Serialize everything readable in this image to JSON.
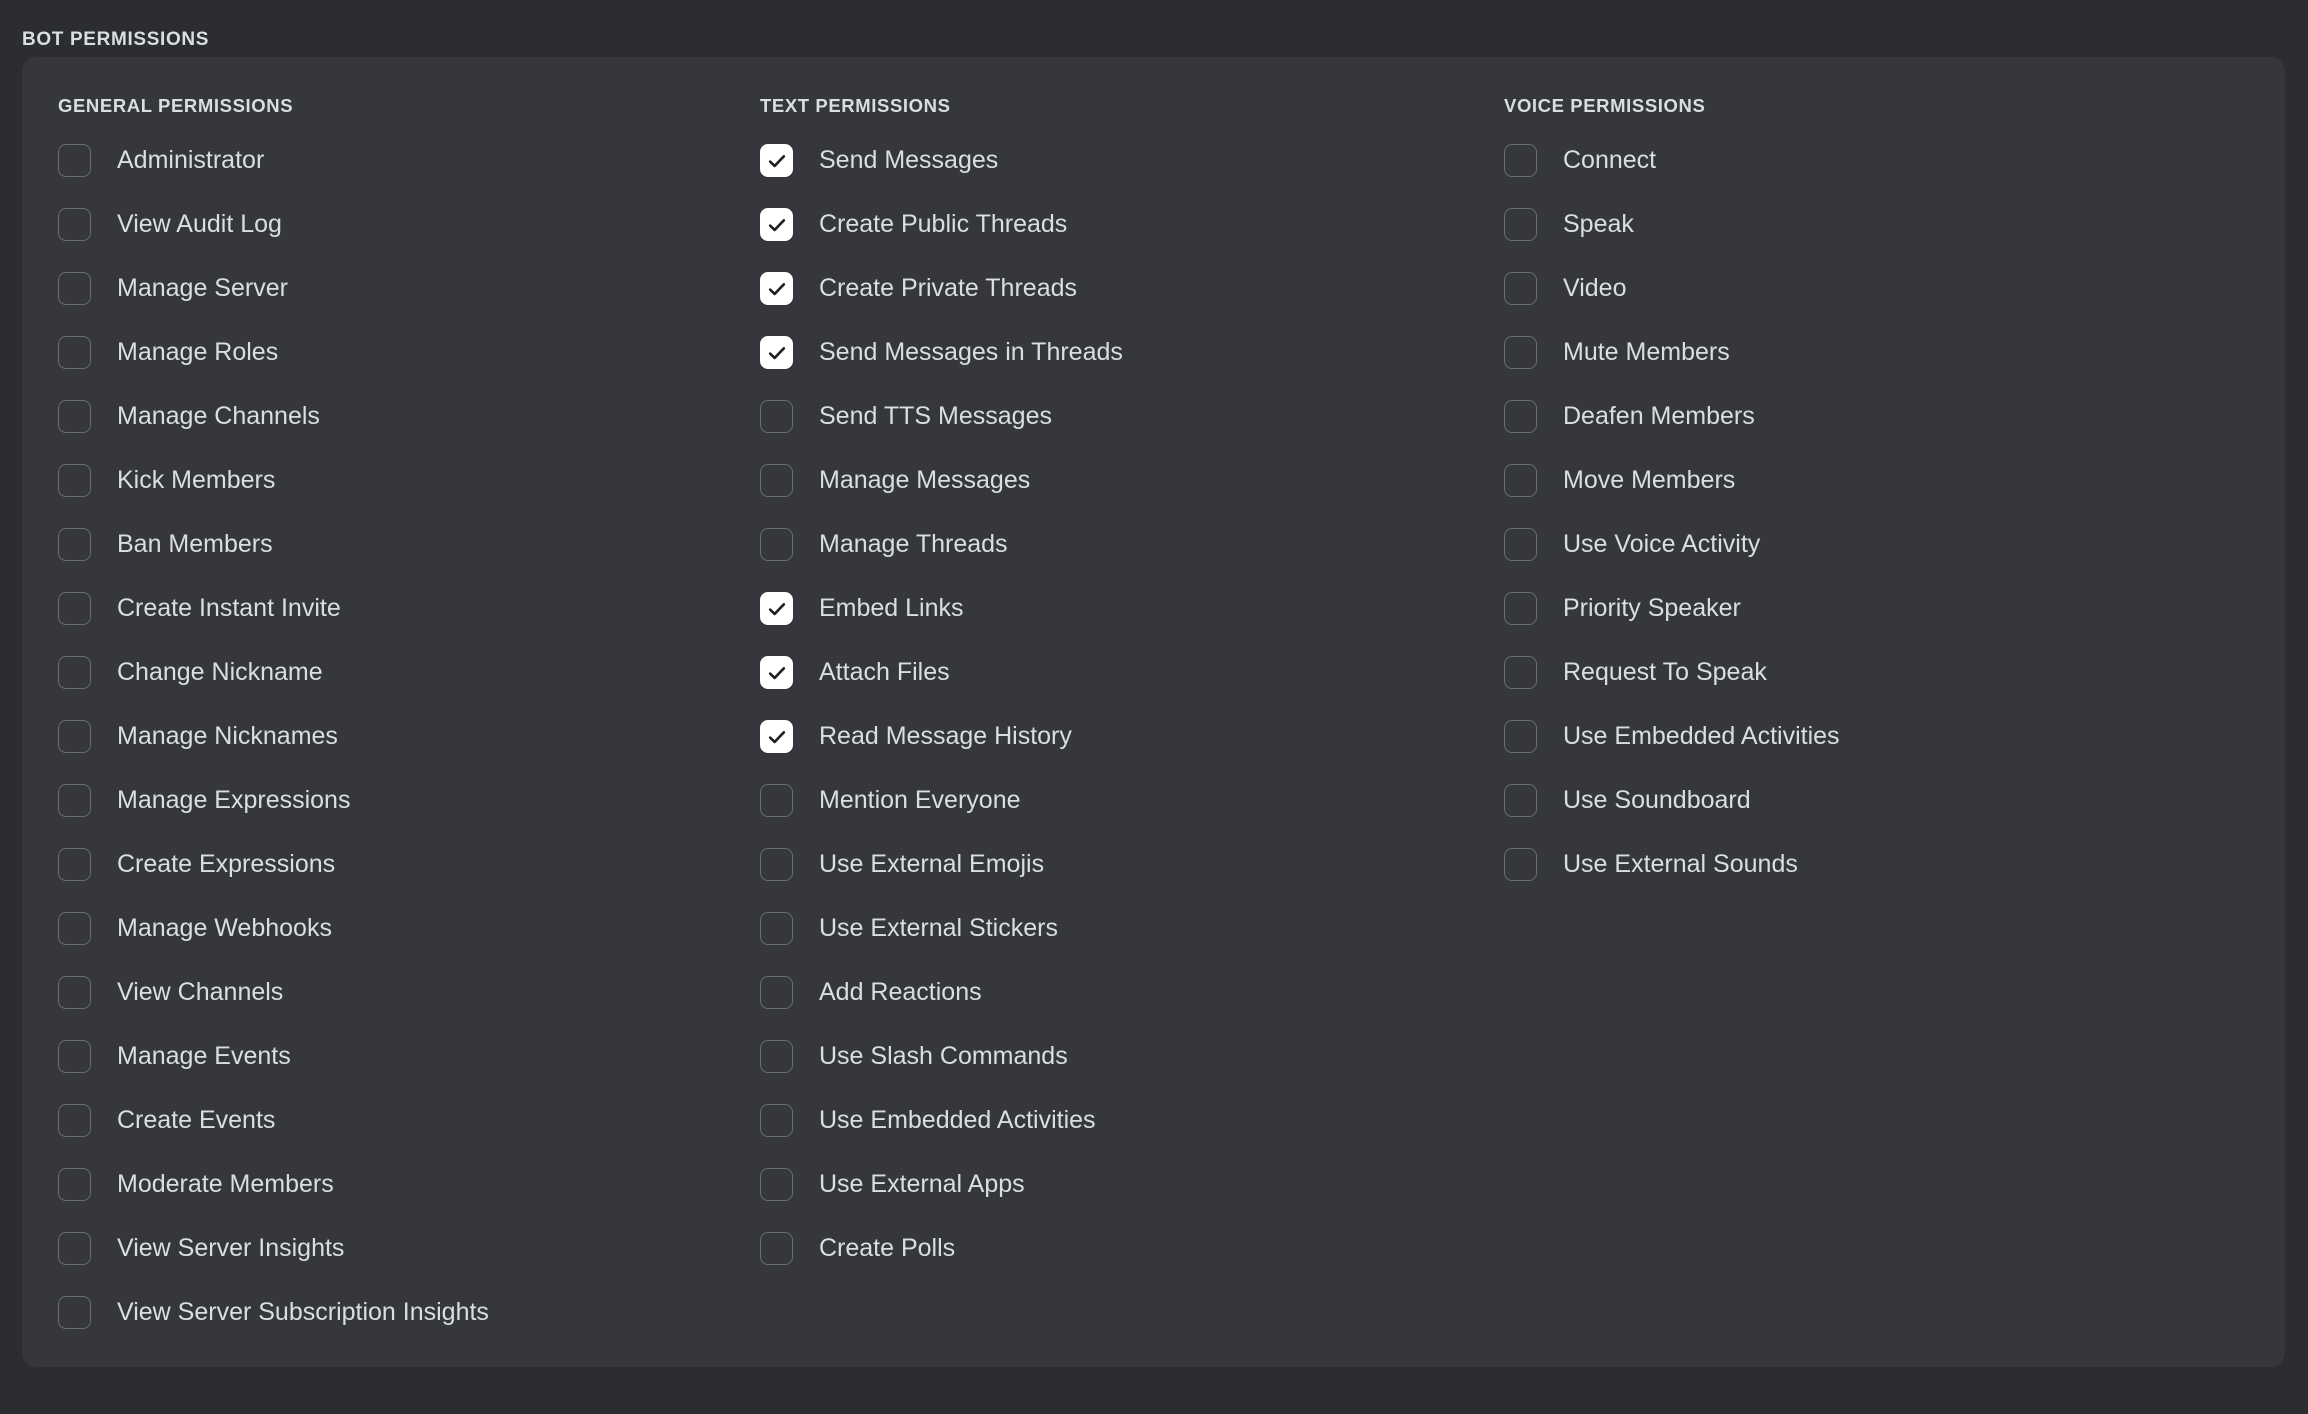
{
  "section": {
    "title": "BOT PERMISSIONS"
  },
  "columns": [
    {
      "id": "general",
      "heading": "GENERAL PERMISSIONS",
      "items": [
        {
          "label": "Administrator",
          "checked": false
        },
        {
          "label": "View Audit Log",
          "checked": false
        },
        {
          "label": "Manage Server",
          "checked": false
        },
        {
          "label": "Manage Roles",
          "checked": false
        },
        {
          "label": "Manage Channels",
          "checked": false
        },
        {
          "label": "Kick Members",
          "checked": false
        },
        {
          "label": "Ban Members",
          "checked": false
        },
        {
          "label": "Create Instant Invite",
          "checked": false
        },
        {
          "label": "Change Nickname",
          "checked": false
        },
        {
          "label": "Manage Nicknames",
          "checked": false
        },
        {
          "label": "Manage Expressions",
          "checked": false
        },
        {
          "label": "Create Expressions",
          "checked": false
        },
        {
          "label": "Manage Webhooks",
          "checked": false
        },
        {
          "label": "View Channels",
          "checked": false
        },
        {
          "label": "Manage Events",
          "checked": false
        },
        {
          "label": "Create Events",
          "checked": false
        },
        {
          "label": "Moderate Members",
          "checked": false
        },
        {
          "label": "View Server Insights",
          "checked": false
        },
        {
          "label": "View Server Subscription Insights",
          "checked": false
        }
      ]
    },
    {
      "id": "text",
      "heading": "TEXT PERMISSIONS",
      "items": [
        {
          "label": "Send Messages",
          "checked": true
        },
        {
          "label": "Create Public Threads",
          "checked": true
        },
        {
          "label": "Create Private Threads",
          "checked": true
        },
        {
          "label": "Send Messages in Threads",
          "checked": true
        },
        {
          "label": "Send TTS Messages",
          "checked": false
        },
        {
          "label": "Manage Messages",
          "checked": false
        },
        {
          "label": "Manage Threads",
          "checked": false
        },
        {
          "label": "Embed Links",
          "checked": true
        },
        {
          "label": "Attach Files",
          "checked": true
        },
        {
          "label": "Read Message History",
          "checked": true
        },
        {
          "label": "Mention Everyone",
          "checked": false
        },
        {
          "label": "Use External Emojis",
          "checked": false
        },
        {
          "label": "Use External Stickers",
          "checked": false
        },
        {
          "label": "Add Reactions",
          "checked": false
        },
        {
          "label": "Use Slash Commands",
          "checked": false
        },
        {
          "label": "Use Embedded Activities",
          "checked": false
        },
        {
          "label": "Use External Apps",
          "checked": false
        },
        {
          "label": "Create Polls",
          "checked": false
        }
      ]
    },
    {
      "id": "voice",
      "heading": "VOICE PERMISSIONS",
      "items": [
        {
          "label": "Connect",
          "checked": false
        },
        {
          "label": "Speak",
          "checked": false
        },
        {
          "label": "Video",
          "checked": false
        },
        {
          "label": "Mute Members",
          "checked": false
        },
        {
          "label": "Deafen Members",
          "checked": false
        },
        {
          "label": "Move Members",
          "checked": false
        },
        {
          "label": "Use Voice Activity",
          "checked": false
        },
        {
          "label": "Priority Speaker",
          "checked": false
        },
        {
          "label": "Request To Speak",
          "checked": false
        },
        {
          "label": "Use Embedded Activities",
          "checked": false
        },
        {
          "label": "Use Soundboard",
          "checked": false
        },
        {
          "label": "Use External Sounds",
          "checked": false
        }
      ]
    }
  ],
  "colors": {
    "page_background": "#2b2d31",
    "panel_background": "#35373c",
    "text": "#dbdee1",
    "checkbox_border": "#6a6d73",
    "checkbox_checked_fill": "#ffffff",
    "checkmark": "#1e1f22"
  }
}
